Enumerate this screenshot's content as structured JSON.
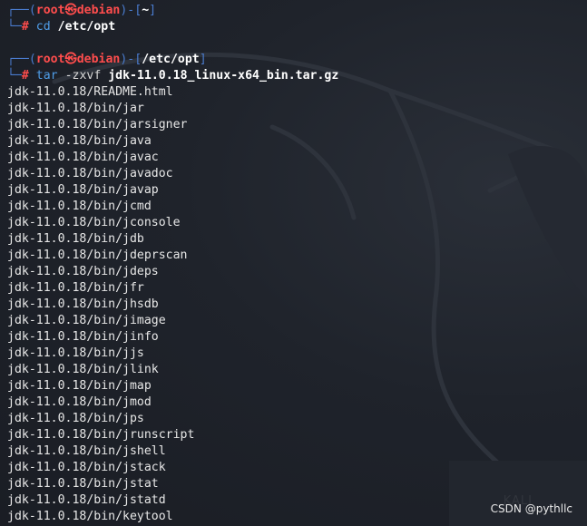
{
  "prompt1": {
    "box_open": "┌──(",
    "user": "root㉿debian",
    "box_mid": ")-[",
    "cwd": "~",
    "box_close": "]",
    "line2_prefix": "└─",
    "hash": "# ",
    "command": "cd",
    "argument": "/etc/opt"
  },
  "prompt2": {
    "box_open": "┌──(",
    "user": "root㉿debian",
    "box_mid": ")-[",
    "cwd": "/etc/opt",
    "box_close": "]",
    "line2_prefix": "└─",
    "hash": "# ",
    "command": "tar",
    "flags": "-zxvf",
    "argument": "jdk-11.0.18_linux-x64_bin.tar.gz"
  },
  "output_lines": [
    "jdk-11.0.18/README.html",
    "jdk-11.0.18/bin/jar",
    "jdk-11.0.18/bin/jarsigner",
    "jdk-11.0.18/bin/java",
    "jdk-11.0.18/bin/javac",
    "jdk-11.0.18/bin/javadoc",
    "jdk-11.0.18/bin/javap",
    "jdk-11.0.18/bin/jcmd",
    "jdk-11.0.18/bin/jconsole",
    "jdk-11.0.18/bin/jdb",
    "jdk-11.0.18/bin/jdeprscan",
    "jdk-11.0.18/bin/jdeps",
    "jdk-11.0.18/bin/jfr",
    "jdk-11.0.18/bin/jhsdb",
    "jdk-11.0.18/bin/jimage",
    "jdk-11.0.18/bin/jinfo",
    "jdk-11.0.18/bin/jjs",
    "jdk-11.0.18/bin/jlink",
    "jdk-11.0.18/bin/jmap",
    "jdk-11.0.18/bin/jmod",
    "jdk-11.0.18/bin/jps",
    "jdk-11.0.18/bin/jrunscript",
    "jdk-11.0.18/bin/jshell",
    "jdk-11.0.18/bin/jstack",
    "jdk-11.0.18/bin/jstat",
    "jdk-11.0.18/bin/jstatd",
    "jdk-11.0.18/bin/keytool"
  ],
  "watermark": "CSDN @pythllc",
  "colors": {
    "background": "#1c1f26",
    "prompt_box": "#4a7ccf",
    "prompt_user": "#ff4d4d",
    "command": "#4f9de8",
    "text": "#e7e7e7"
  }
}
